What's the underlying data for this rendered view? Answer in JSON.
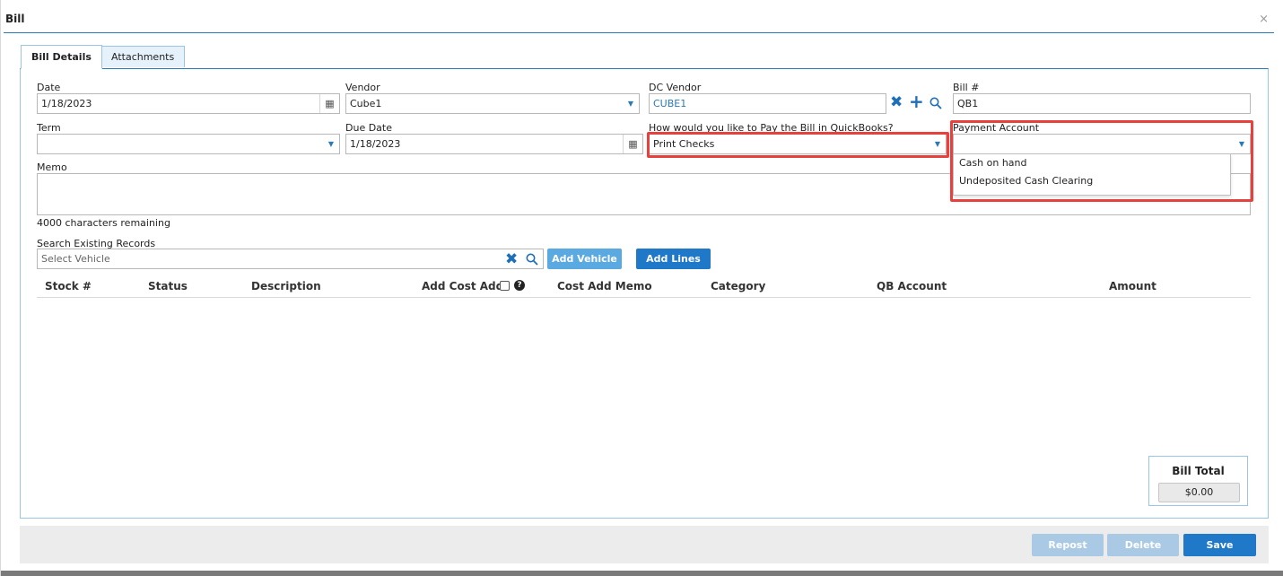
{
  "window": {
    "title": "Bill",
    "close_label": "×"
  },
  "tabs": [
    {
      "label": "Bill Details",
      "active": true
    },
    {
      "label": "Attachments",
      "active": false
    }
  ],
  "form": {
    "date": {
      "label": "Date",
      "value": "1/18/2023"
    },
    "vendor": {
      "label": "Vendor",
      "value": "Cube1"
    },
    "dc_vendor": {
      "label": "DC Vendor",
      "value": "CUBE1"
    },
    "bill_number": {
      "label": "Bill #",
      "value": "QB1"
    },
    "term": {
      "label": "Term",
      "value": ""
    },
    "due_date": {
      "label": "Due Date",
      "value": "1/18/2023"
    },
    "pay_method": {
      "label": "How would you like to Pay the Bill in QuickBooks?",
      "value": "Print Checks"
    },
    "payment_account": {
      "label": "Payment Account",
      "value": "",
      "options": [
        "Cash on hand",
        "Undeposited Cash Clearing"
      ]
    },
    "memo": {
      "label": "Memo",
      "value": "",
      "chars_remaining": "4000 characters remaining"
    },
    "search": {
      "label": "Search Existing Records",
      "placeholder": "Select Vehicle"
    }
  },
  "buttons": {
    "add_vehicle": "Add Vehicle",
    "add_lines": "Add Lines",
    "repost": "Repost",
    "delete": "Delete",
    "save": "Save"
  },
  "table": {
    "columns": {
      "stock": "Stock #",
      "status": "Status",
      "description": "Description",
      "add_cost_add": "Add Cost Add",
      "cost_add_memo": "Cost Add Memo",
      "category": "Category",
      "qb_account": "QB Account",
      "amount": "Amount"
    },
    "rows": []
  },
  "totals": {
    "label": "Bill Total",
    "value": "$0.00"
  },
  "colors": {
    "accent": "#1f78c8",
    "highlight": "#e8403d",
    "tab_border": "#9bc5e3"
  }
}
